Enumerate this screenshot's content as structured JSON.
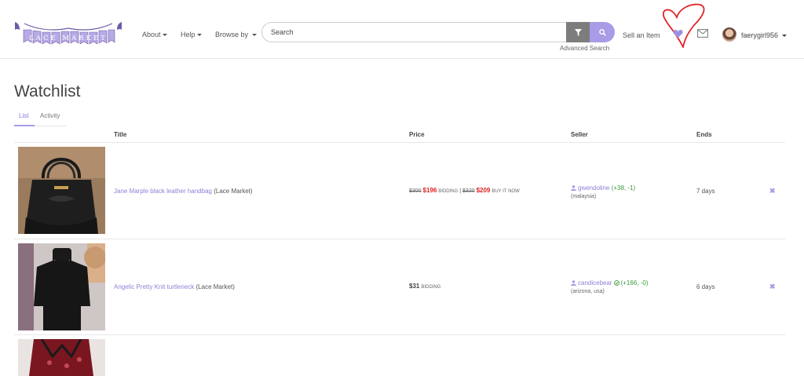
{
  "navbar": {
    "logo_text": "LACE MARKET",
    "about": "About",
    "help": "Help",
    "browse": "Browse by",
    "search_placeholder": "Search",
    "advanced_search": "Advanced Search",
    "sell": "Sell an Item",
    "username": "faerygirl956",
    "colors": {
      "accent": "#a99be5",
      "filter": "#7d7d7d",
      "scribble": "#e0242a"
    }
  },
  "page": {
    "title": "Watchlist",
    "tabs": [
      {
        "label": "List",
        "active": true
      },
      {
        "label": "Activity",
        "active": false
      }
    ]
  },
  "table": {
    "headers": {
      "title": "Title",
      "price": "Price",
      "seller": "Seller",
      "ends": "Ends"
    },
    "rows": [
      {
        "title": "Jane Marple black leather handbag",
        "source": "(Lace Market)",
        "price_old_bid": "$300",
        "price_bid": "$196",
        "bid_label": "BIDDING",
        "sep": "|",
        "price_old_buy": "$320",
        "price_buy": "$209",
        "buy_label": "BUY IT NOW",
        "seller": "gwendoline",
        "score": "(+38, -1)",
        "location": "(malaysia)",
        "ends": "7 days",
        "remove": "✖",
        "image": "black-handbag"
      },
      {
        "title": "Angelic Pretty Knit turtleneck",
        "source": "(Lace Market)",
        "price_bid": "$31",
        "bid_label": "BIDDING",
        "seller": "candicebear",
        "score": "(+166, -0)",
        "location": "(arizona, usa)",
        "ends": "6 days",
        "remove": "✖",
        "image": "black-turtleneck"
      },
      {
        "image": "red-dress"
      }
    ]
  }
}
